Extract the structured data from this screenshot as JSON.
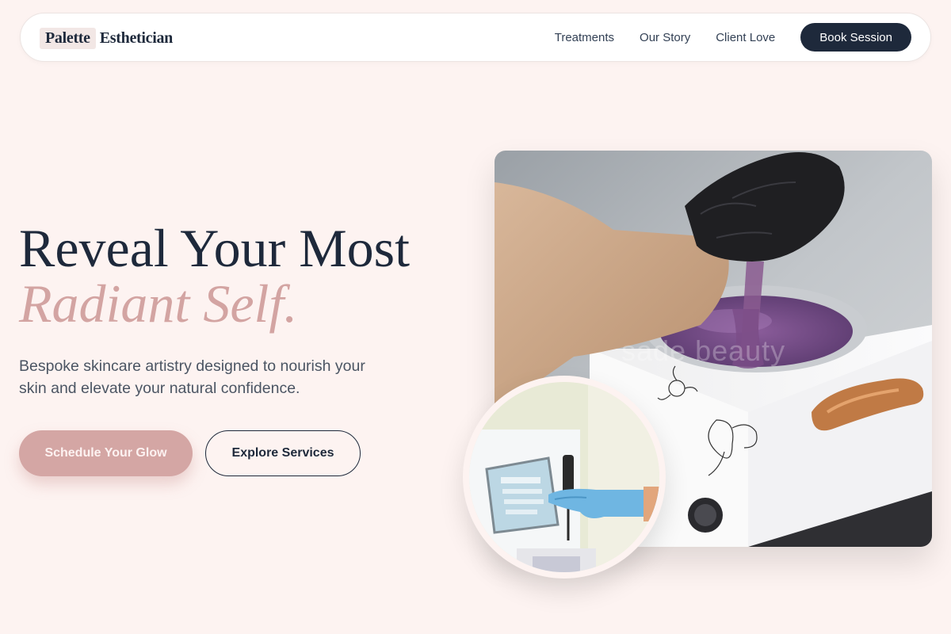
{
  "brand": {
    "part1": "Palette",
    "part2": "Esthetician"
  },
  "nav": {
    "links": [
      "Treatments",
      "Our Story",
      "Client Love"
    ],
    "cta": "Book Session"
  },
  "hero": {
    "headline_line1": "Reveal Your Most",
    "headline_line2": "Radiant Self.",
    "subtext": "Bespoke skincare artistry designed to nourish your skin and elevate your natural confidence.",
    "primary_button": "Schedule Your Glow",
    "secondary_button": "Explore Services"
  },
  "images": {
    "main_watermark": "sade beauty"
  },
  "colors": {
    "background": "#fdf3f1",
    "navy": "#1e293b",
    "rose": "#d4a6a4",
    "rose_text": "#d3a4a2"
  }
}
